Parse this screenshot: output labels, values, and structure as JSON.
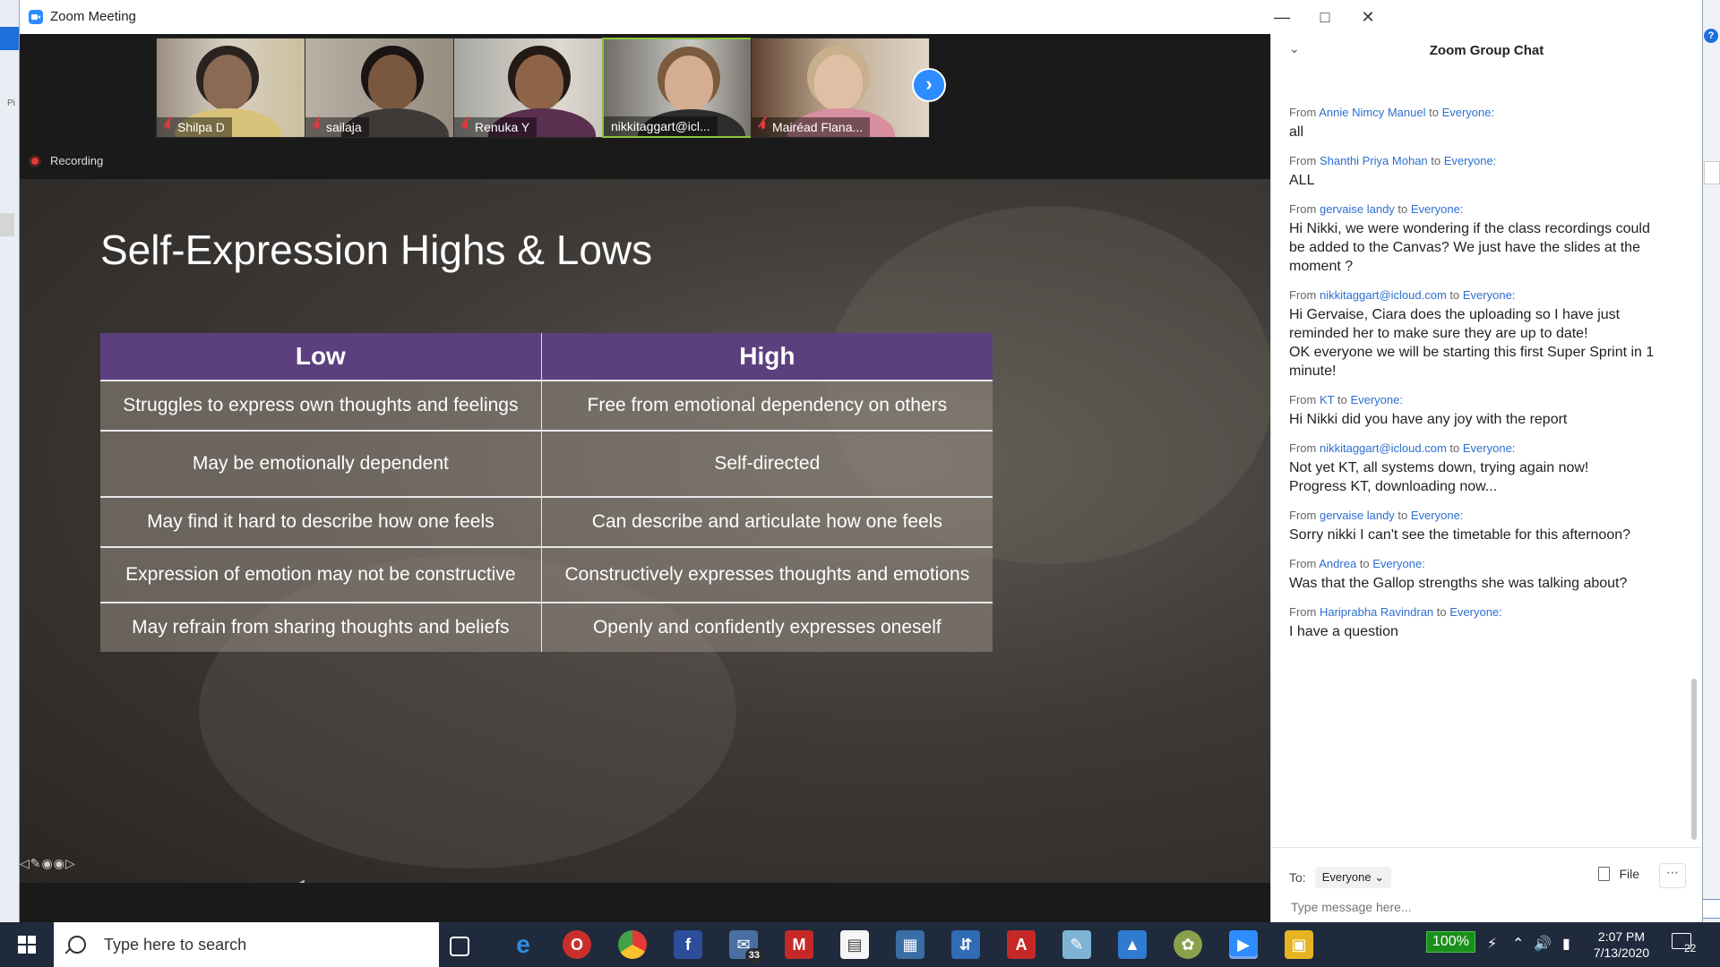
{
  "window": {
    "title": "Zoom Meeting"
  },
  "participants": [
    {
      "name": "Shilpa D",
      "muted": true
    },
    {
      "name": "sailaja",
      "muted": true
    },
    {
      "name": "Renuka Y",
      "muted": true
    },
    {
      "name": "nikkitaggart@icl...",
      "muted": false,
      "active_speaker": true
    },
    {
      "name": "Mairéad Flana...",
      "muted": true
    }
  ],
  "recording_label": "Recording",
  "slide": {
    "title": "Self-Expression Highs & Lows",
    "table": {
      "headers": [
        "Low",
        "High"
      ],
      "rows": [
        [
          "Struggles to express own thoughts and feelings",
          "Free from emotional dependency on others"
        ],
        [
          "May be emotionally dependent",
          "Self-directed"
        ],
        [
          "May find it hard to describe how one feels",
          "Can describe and articulate how one feels"
        ],
        [
          "Expression of emotion may not be constructive",
          "Constructively expresses thoughts and emotions"
        ],
        [
          "May refrain from sharing thoughts and beliefs",
          "Openly and confidently expresses oneself"
        ]
      ]
    }
  },
  "chat": {
    "title": "Zoom Group Chat",
    "messages": [
      {
        "from": "Annie Nimcy Manuel",
        "to": "Everyone:",
        "lines": [
          "all"
        ]
      },
      {
        "from": "Shanthi Priya Mohan",
        "to": "Everyone:",
        "lines": [
          "ALL"
        ]
      },
      {
        "from": "gervaise landy",
        "to": "Everyone:",
        "lines": [
          "Hi Nikki, we were wondering if the class recordings could be added to the Canvas? We just have the slides at the moment ?"
        ]
      },
      {
        "from": "nikkitaggart@icloud.com",
        "to": "Everyone:",
        "lines": [
          "Hi Gervaise, Ciara does the uploading so I have just reminded her to make sure they are up to date!",
          "OK everyone we will be starting this first Super Sprint in 1 minute!"
        ]
      },
      {
        "from": "KT",
        "to": "Everyone:",
        "lines": [
          "Hi Nikki did you have any joy with the report"
        ]
      },
      {
        "from": "nikkitaggart@icloud.com",
        "to": "Everyone:",
        "lines": [
          "Not yet KT, all systems down, trying again now!",
          "Progress KT, downloading now..."
        ]
      },
      {
        "from": "gervaise landy",
        "to": "Everyone:",
        "lines": [
          "Sorry nikki I can't see the timetable for this afternoon?"
        ]
      },
      {
        "from": "Andrea",
        "to": "Everyone:",
        "lines": [
          "Was that the Gallop strengths she was talking about?"
        ]
      },
      {
        "from": "Hariprabha Ravindran",
        "to": "Everyone:",
        "lines": [
          "I have a question"
        ]
      }
    ],
    "from_prefix": "From",
    "to_word": "to",
    "to_label": "To:",
    "to_value": "Everyone",
    "file_label": "File",
    "input_placeholder": "Type message here..."
  },
  "taskbar": {
    "search_placeholder": "Type here to search",
    "mail_badge": "33",
    "battery": "100%",
    "time": "2:07 PM",
    "date": "7/13/2020",
    "notifications": "22"
  }
}
